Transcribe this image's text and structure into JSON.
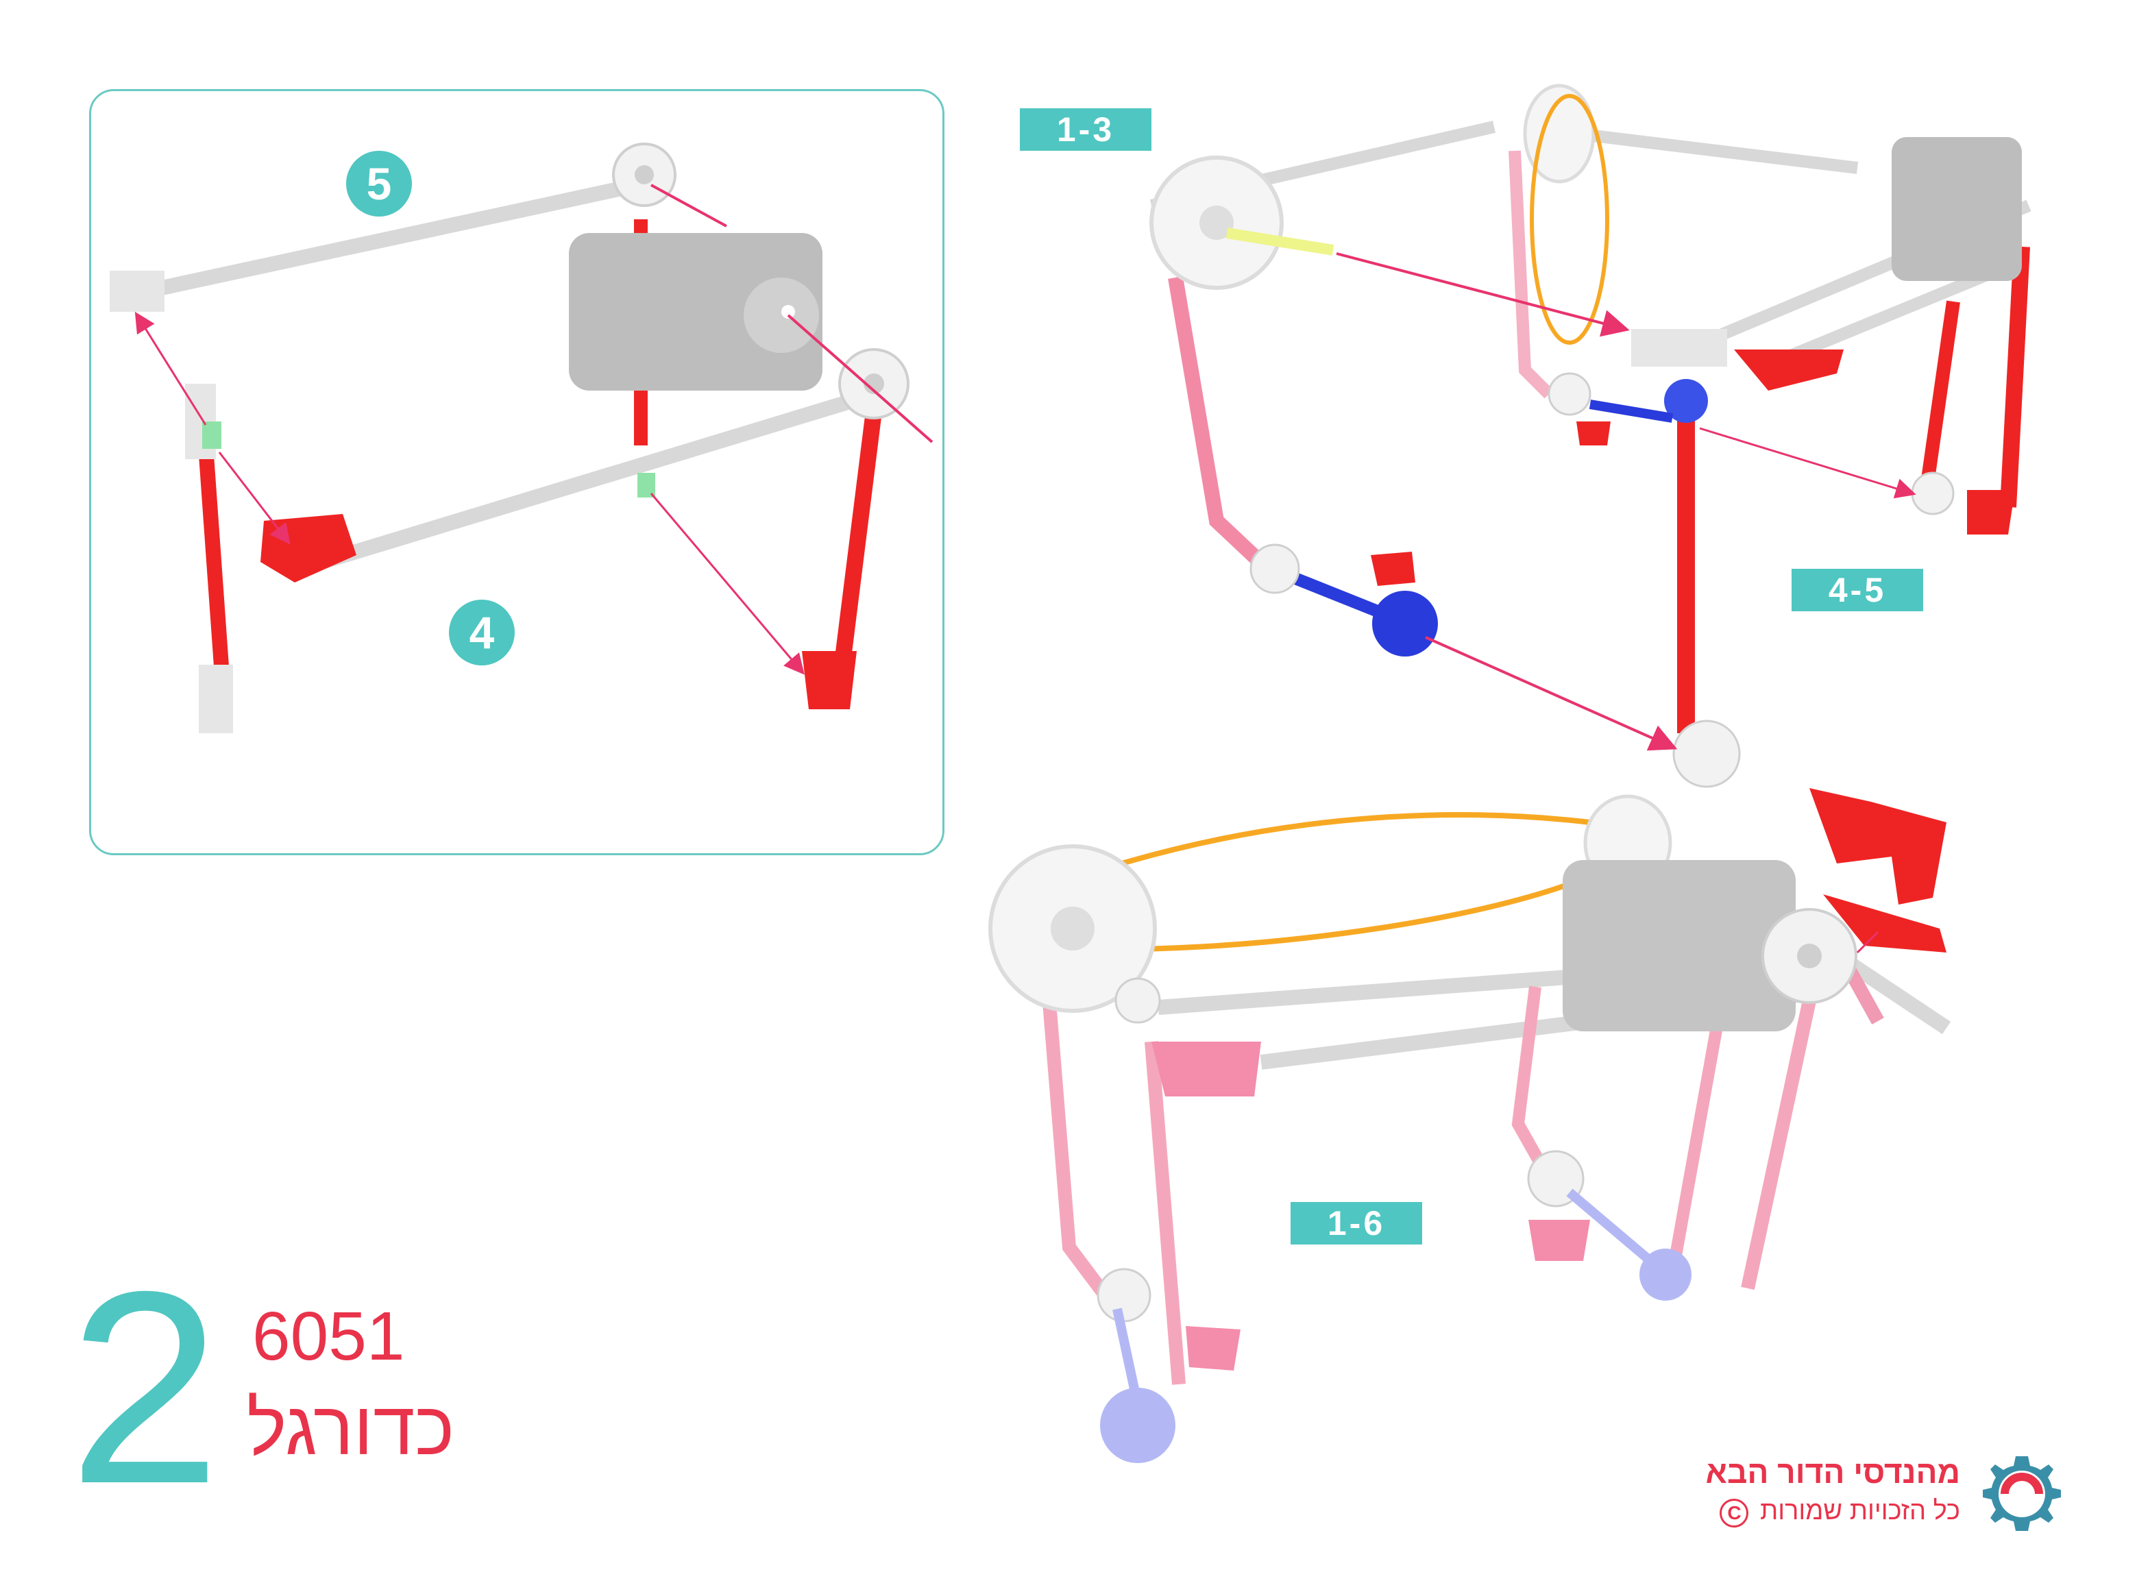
{
  "inset": {
    "step_a": "5",
    "step_b": "4"
  },
  "stages": {
    "first": "1-3",
    "second": "4-5",
    "third": "1-6"
  },
  "title": {
    "number": "2",
    "model_number": "6051",
    "model_name": "כדורגל"
  },
  "brand": {
    "name": "מהנדסי הדור הבא",
    "copyright": "כל הזכויות שמורות",
    "logo_icon": "gear-logo-icon"
  },
  "colors": {
    "accent": "#4fc6c1",
    "brand_red": "#e8334b",
    "rod_grey": "#dcdcdc",
    "connector_red": "#ee2424",
    "connector_blue": "#2a3bdc",
    "band_orange": "#f7a823",
    "guide_pink": "#e8336d"
  }
}
